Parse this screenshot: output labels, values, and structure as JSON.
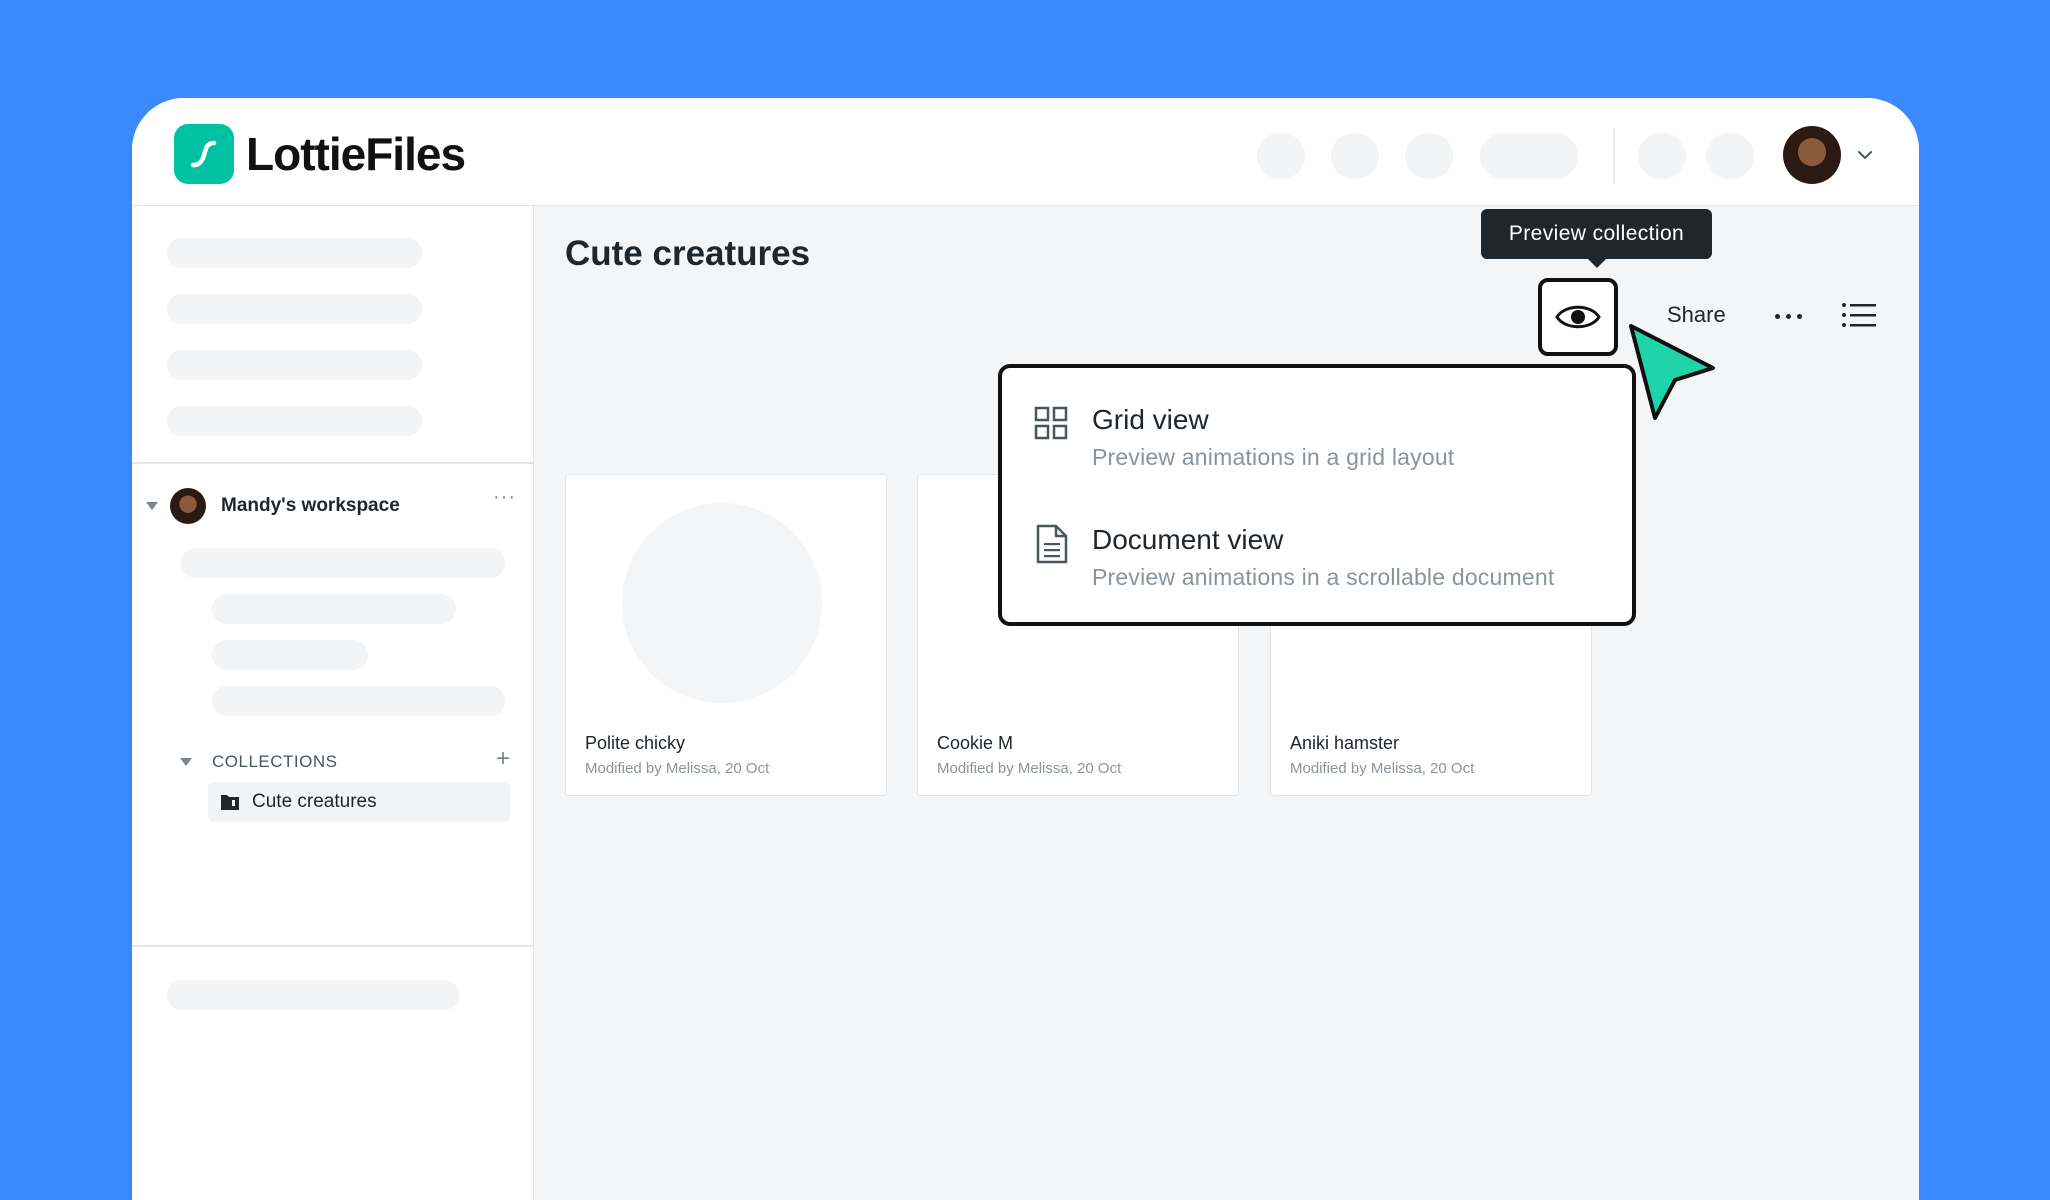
{
  "brand": {
    "name": "LottieFiles",
    "accent": "#00C1A2",
    "background": "#3B88FF"
  },
  "header": {
    "avatar_icon": "user-avatar",
    "menu_icon": "chevron-down-icon"
  },
  "sidebar": {
    "workspace": {
      "name": "Mandy's workspace",
      "more_label": "···"
    },
    "collections": {
      "label": "COLLECTIONS",
      "add_label": "+",
      "items": [
        {
          "label": "Cute creatures"
        }
      ]
    }
  },
  "main": {
    "title": "Cute creatures",
    "tooltip": "Preview collection",
    "toolbar": {
      "share_label": "Share"
    },
    "cards": [
      {
        "title": "Polite chicky",
        "meta": "Modified by Melissa, 20 Oct"
      },
      {
        "title": "Cookie M",
        "meta": "Modified by Melissa, 20 Oct"
      },
      {
        "title": "Aniki hamster",
        "meta": "Modified by Melissa, 20 Oct"
      }
    ],
    "preview_menu": {
      "items": [
        {
          "title": "Grid view",
          "subtitle": "Preview animations in a grid layout",
          "icon": "grid-icon"
        },
        {
          "title": "Document view",
          "subtitle": "Preview animations in a scrollable document",
          "icon": "document-icon"
        }
      ]
    }
  }
}
